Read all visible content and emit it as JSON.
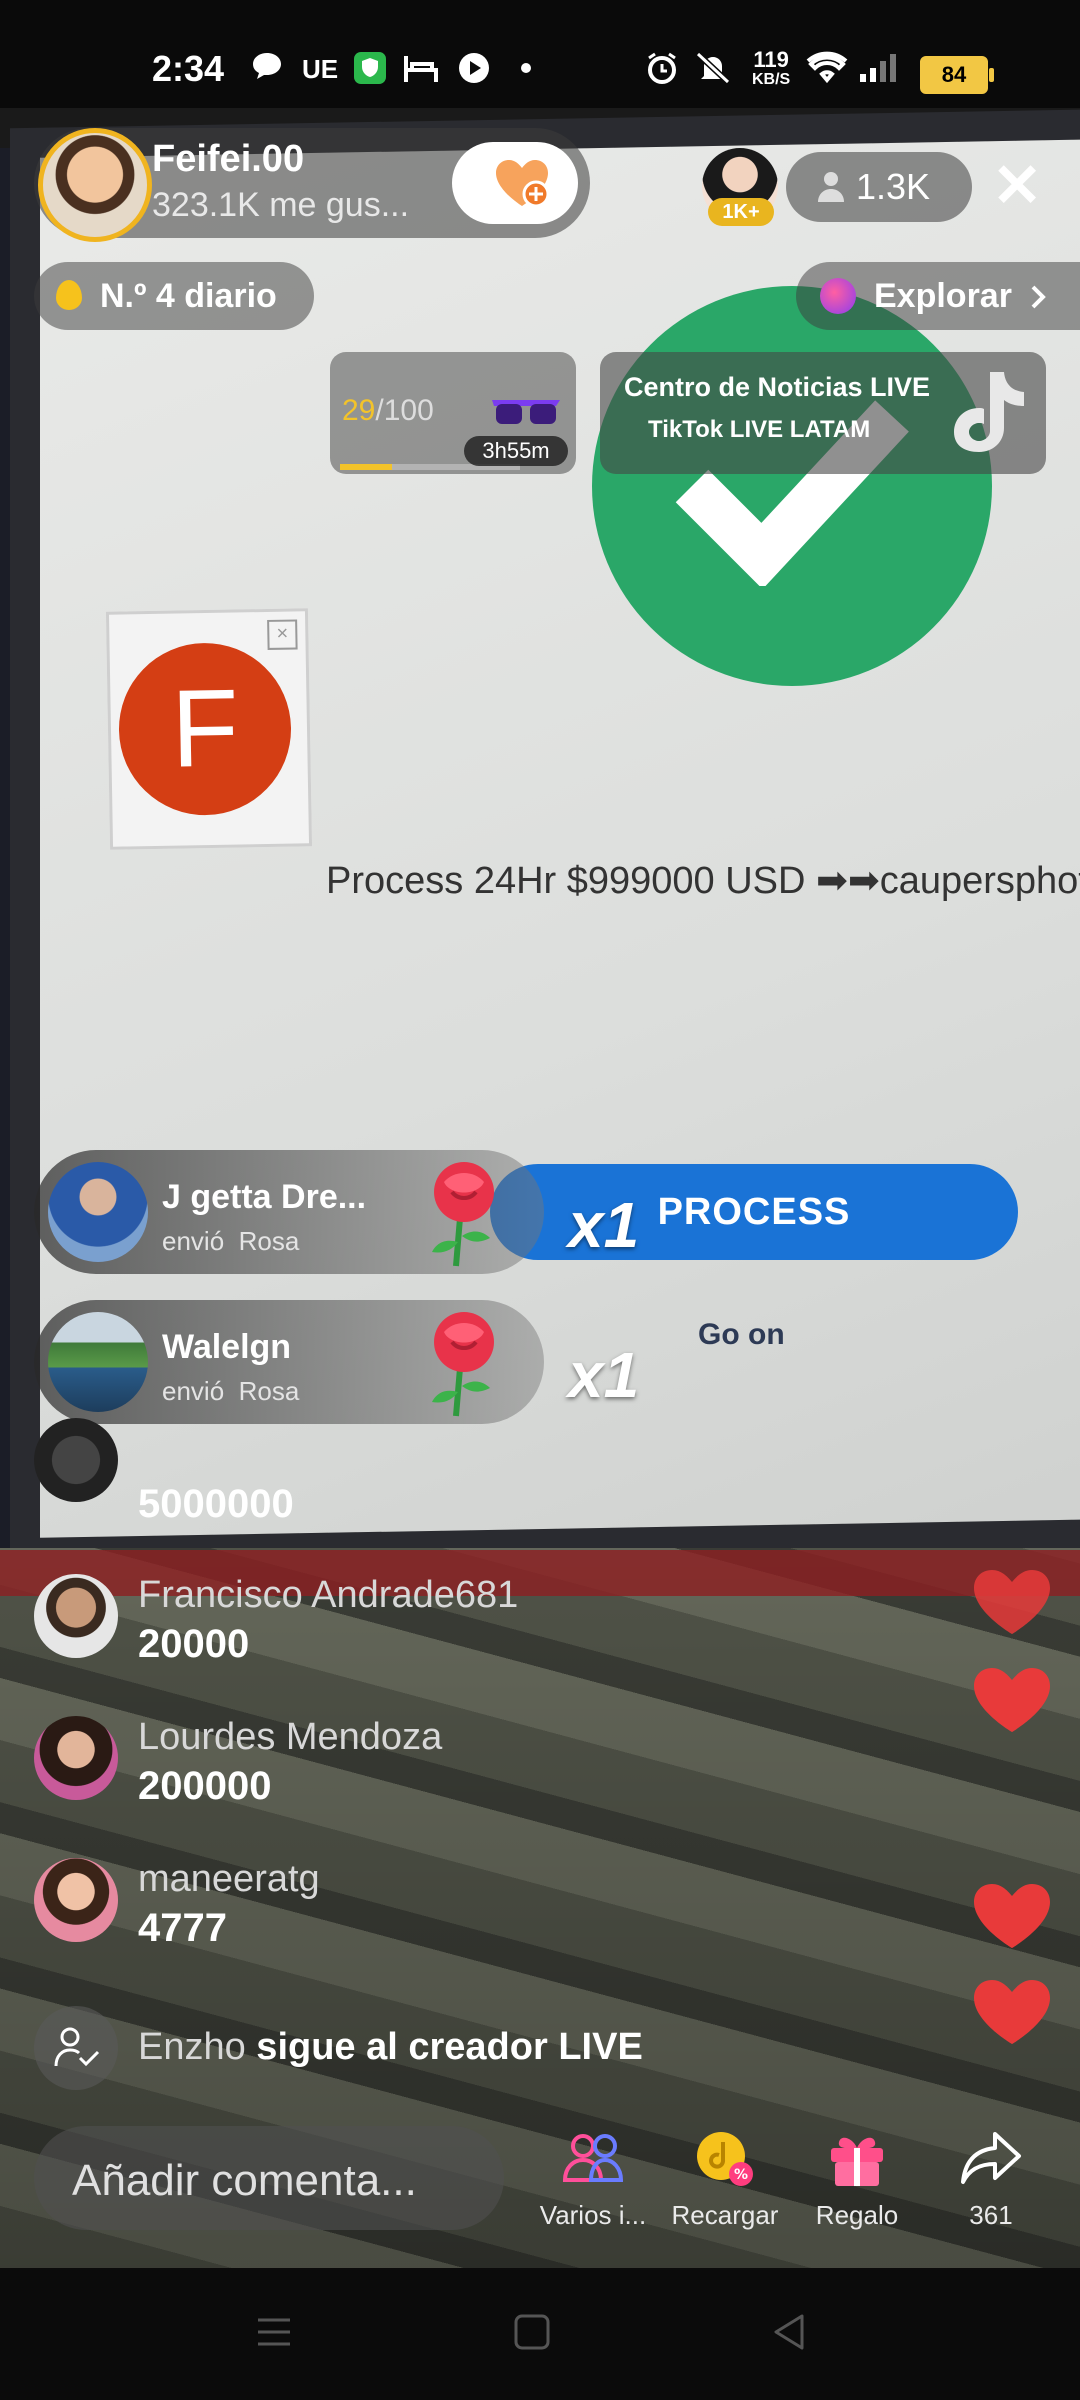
{
  "status_bar": {
    "time": "2:34",
    "carrier": "UE",
    "speed_value": "119",
    "speed_unit": "KB/S",
    "battery": "84",
    "icons": [
      "chat-bubble-icon",
      "shield-icon",
      "bed-icon",
      "play-icon",
      "dot-icon",
      "alarm-icon",
      "mute-icon",
      "wifi-icon",
      "signal-icon",
      "battery-icon"
    ]
  },
  "host": {
    "name": "Feifei.00",
    "likes": "323.1K me gus...",
    "follow_icon": "heart-plus-icon"
  },
  "viewers": {
    "badge": "1K+",
    "count": "1.3K"
  },
  "rank": {
    "label": "N.º 4 diario"
  },
  "explore": {
    "label": "Explorar"
  },
  "goal": {
    "current": "29",
    "total": "/100",
    "progress": 0.29,
    "time_left": "3h55m"
  },
  "news": {
    "title": "Centro de Noticias LIVE",
    "subtitle": "TikTok LIVE LATAM"
  },
  "stream_content": {
    "f_logo": "F",
    "process_text": "Process 24Hr $999000 USD ➡➡caupersphot",
    "process_button": "PROCESS",
    "go_on": "Go on"
  },
  "gifts": [
    {
      "user": "J getta Dre...",
      "action": "envió",
      "gift": "Rosa",
      "count": "x1"
    },
    {
      "user": "Walelgn",
      "action": "envió",
      "gift": "Rosa",
      "count": "x1"
    }
  ],
  "comments": [
    {
      "user": "",
      "text": "5000000"
    },
    {
      "user": "Francisco Andrade681",
      "text": "20000"
    },
    {
      "user": "Lourdes Mendoza",
      "text": "200000"
    },
    {
      "user": "maneeratg",
      "text": "4777"
    }
  ],
  "join_event": {
    "user": "Enzho",
    "text": " sigue al creador LIVE"
  },
  "bottom_bar": {
    "comment_placeholder": "Añadir comenta...",
    "actions": [
      {
        "label": "Varios i...",
        "icon": "multi-guest-icon"
      },
      {
        "label": "Recargar",
        "icon": "coin-recharge-icon"
      },
      {
        "label": "Regalo",
        "icon": "gift-icon"
      },
      {
        "label": "361",
        "icon": "share-icon"
      }
    ]
  },
  "colors": {
    "accent_red": "#e83a3a",
    "gold": "#f3c32a",
    "process_blue": "#1a73d6",
    "check_green": "#2aa768"
  }
}
